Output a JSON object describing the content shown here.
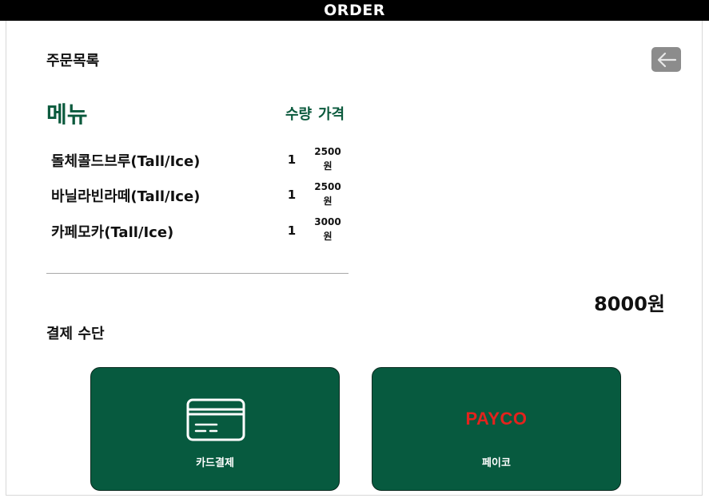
{
  "header": {
    "title": "ORDER"
  },
  "order": {
    "section_title": "주문목록",
    "columns": {
      "menu": "메뉴",
      "quantity": "수량",
      "price": "가격"
    },
    "items": [
      {
        "name": "돌체콜드브루(Tall/Ice)",
        "quantity": "1",
        "price": "2500",
        "currency": "원"
      },
      {
        "name": "바닐라빈라떼(Tall/Ice)",
        "quantity": "1",
        "price": "2500",
        "currency": "원"
      },
      {
        "name": "카페모카(Tall/Ice)",
        "quantity": "1",
        "price": "3000",
        "currency": "원"
      }
    ],
    "total": "8000원"
  },
  "payment": {
    "section_title": "결제 수단",
    "methods": [
      {
        "label": "카드결제",
        "icon": "credit-card-icon"
      },
      {
        "label": "페이코",
        "logo_text": "PAYCO"
      }
    ]
  },
  "colors": {
    "accent_green": "#075a3f",
    "heading_green": "#0b5a3d",
    "payco_red": "#e3231d",
    "back_button_gray": "#8c8c8c"
  },
  "icons": {
    "back": "arrow-left-icon"
  }
}
